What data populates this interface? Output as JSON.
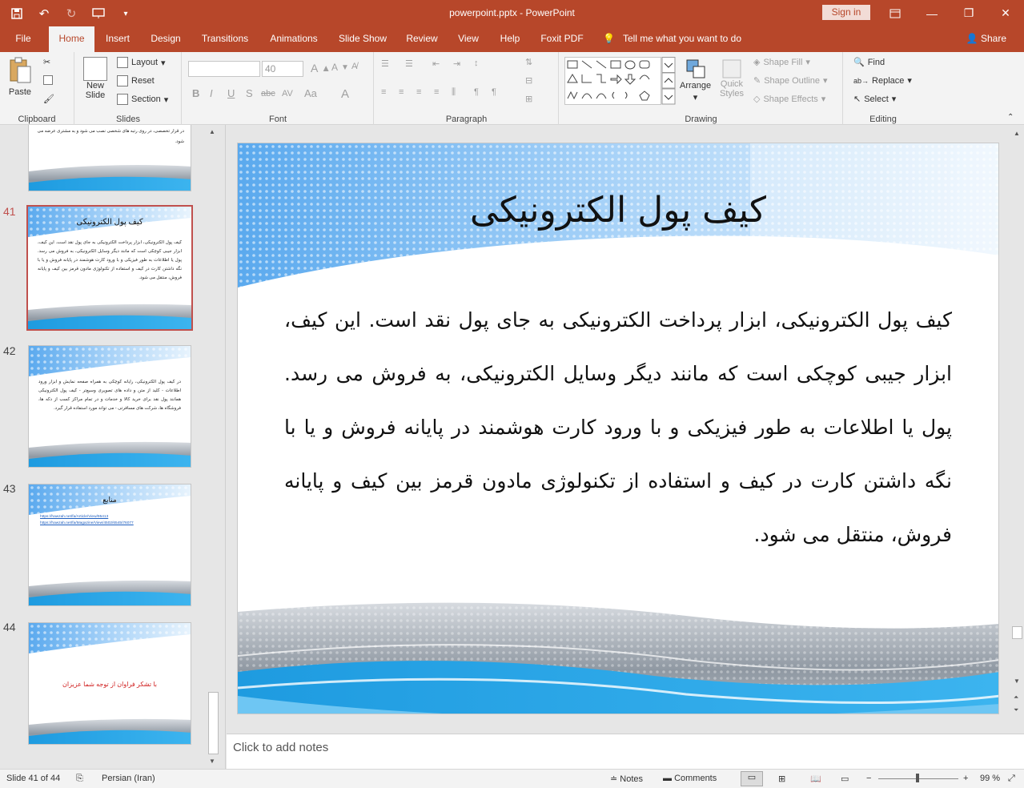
{
  "titlebar": {
    "document_title": "powerpoint.pptx - PowerPoint",
    "signin": "Sign in"
  },
  "tabs": {
    "file": "File",
    "home": "Home",
    "insert": "Insert",
    "design": "Design",
    "transitions": "Transitions",
    "animations": "Animations",
    "slideshow": "Slide Show",
    "review": "Review",
    "view": "View",
    "help": "Help",
    "foxit": "Foxit PDF",
    "tellme": "Tell me what you want to do",
    "share": "Share"
  },
  "ribbon": {
    "clipboard": {
      "label": "Clipboard",
      "paste": "Paste"
    },
    "slides": {
      "label": "Slides",
      "new_slide_1": "New",
      "new_slide_2": "Slide",
      "layout": "Layout",
      "reset": "Reset",
      "section": "Section"
    },
    "font": {
      "label": "Font",
      "size": "40",
      "bold": "B",
      "italic": "I",
      "underline": "U",
      "shadow": "S",
      "strike": "abc",
      "spacing": "AV",
      "case": "Aa",
      "color": "A"
    },
    "paragraph": {
      "label": "Paragraph"
    },
    "drawing": {
      "label": "Drawing",
      "arrange": "Arrange",
      "quick_styles_1": "Quick",
      "quick_styles_2": "Styles",
      "shape_fill": "Shape Fill",
      "shape_outline": "Shape Outline",
      "shape_effects": "Shape Effects"
    },
    "editing": {
      "label": "Editing",
      "find": "Find",
      "replace": "Replace",
      "select": "Select"
    }
  },
  "thumbnails": [
    {
      "num": "",
      "title": "",
      "body": "در قرار تخصصی، در روی رتبه های شخصی نصب می شود و به مشتری عرضه می شود."
    },
    {
      "num": "41",
      "title": "کیف پول الکترونیکی",
      "body": "کیف پول الکترونیکی، ابزار پرداخت الکترونیکی به جای پول نقد است. این کیف، ابزار جیبی کوچکی است که مانند دیگر وسایل الکترونیکی، به فروش می رسد. پول یا اطلاعات به طور فیزیکی و با ورود کارت هوشمند در پایانه فروش و یا با نگه داشتن کارت در کیف و استفاده از تکنولوژی مادون قرمز بین کیف و پایانه فروش، منتقل می شود."
    },
    {
      "num": "42",
      "title": "",
      "body": "در کیف پول الکترونیکی، رایانه کوچکی به همراه صفحه نمایش و ابزار ورود اطلاعات - کلید از متن و داده های تصویری وسیع‌تر - کیف پول الکترونیکی همانند پول نقد برای خرید کالا و خدمات و در تمام مراکز کسب از دکه ها، فروشگاه ها، شرکت های مسافرتی - می تواند مورد استفاده قرار گیرد."
    },
    {
      "num": "43",
      "title": "منابع",
      "links": [
        "https://hawzah.net/fa/Article/View/95413",
        "https://hawzah.net/fa/Magazine/View/4502/6545/76077"
      ]
    },
    {
      "num": "44",
      "title": "",
      "body": "با تشکر فراوان از توجه شما عزیزان"
    }
  ],
  "slide": {
    "title": "کیف پول الکترونیکی",
    "body": "کیف پول الکترونیکی، ابزار پرداخت الکترونیکی به جای پول نقد است. این کیف، ابزار جیبی کوچکی است که مانند دیگر وسایل الکترونیکی، به فروش می رسد. پول یا اطلاعات به طور فیزیکی و با ورود کارت هوشمند در پایانه فروش و یا با نگه داشتن کارت در کیف و استفاده از تکنولوژی مادون قرمز بین کیف و پایانه فروش، منتقل می شود."
  },
  "notes": {
    "placeholder": "Click to add notes"
  },
  "status": {
    "slide_info": "Slide 41 of 44",
    "language": "Persian (Iran)",
    "notes": "Notes",
    "comments": "Comments",
    "zoom": "99 %"
  },
  "colors": {
    "accent": "#b7472a",
    "selected_thumb": "#c0504d",
    "thumb_red_text": "#d02020"
  }
}
